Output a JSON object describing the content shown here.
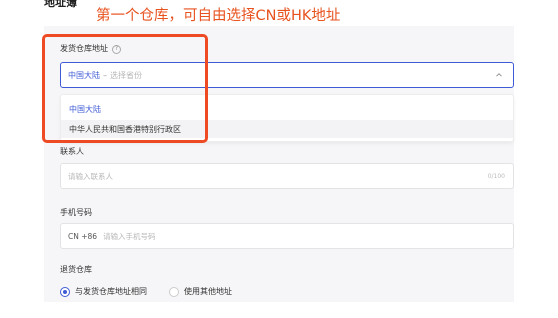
{
  "page_title": "地址簿",
  "annotation": "第一个仓库，可自由选择CN或HK地址",
  "ship_from": {
    "label": "发货仓库地址",
    "help_icon": "?",
    "selected_value": "中国大陆",
    "separator": "–",
    "placeholder": "选择省份",
    "options": [
      "中国大陆",
      "中华人民共和国香港特别行政区"
    ]
  },
  "contact": {
    "label": "联系人",
    "placeholder": "请输入联系人",
    "counter": "0/100"
  },
  "phone": {
    "label": "手机号码",
    "prefix": "CN +86",
    "placeholder": "请输入手机号码"
  },
  "return_warehouse": {
    "label": "退货仓库",
    "options": [
      "与发货仓库地址相同",
      "使用其他地址"
    ],
    "selected_index": 0
  },
  "colors": {
    "accent": "#3e5bd6",
    "annotation": "#e8521f",
    "highlight_border": "#ee4a23"
  }
}
